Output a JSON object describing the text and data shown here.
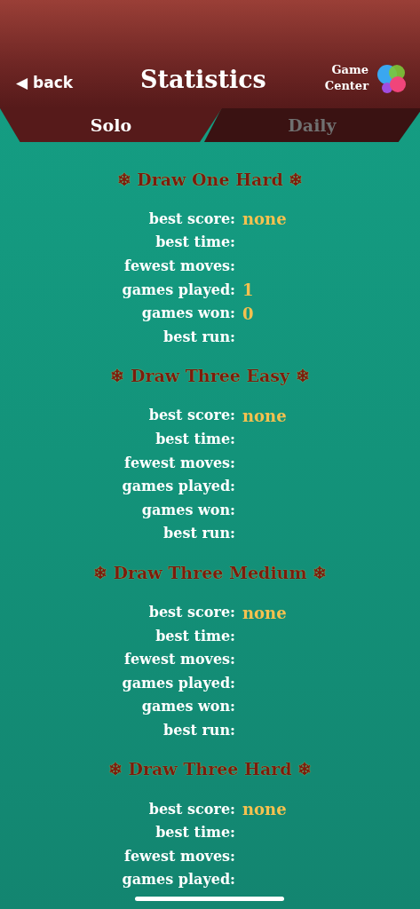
{
  "header": {
    "back": "◀ back",
    "title": "Statistics",
    "game_center": [
      "Game",
      "Center"
    ]
  },
  "tabs": [
    {
      "label": "Solo",
      "selected": true
    },
    {
      "label": "Daily",
      "selected": false
    }
  ],
  "sections": [
    {
      "title": "Draw One Hard",
      "rows": [
        {
          "label": "best score:",
          "value": "none"
        },
        {
          "label": "best time:"
        },
        {
          "label": "fewest moves:"
        },
        {
          "label": "games played:",
          "value": "1"
        },
        {
          "label": "games won:",
          "value": "0"
        },
        {
          "label": "best run:"
        }
      ]
    },
    {
      "title": "Draw Three Easy",
      "rows": [
        {
          "label": "best score:",
          "value": "none"
        },
        {
          "label": "best time:"
        },
        {
          "label": "fewest moves:"
        },
        {
          "label": "games played:"
        },
        {
          "label": "games won:"
        },
        {
          "label": "best run:"
        }
      ]
    },
    {
      "title": "Draw Three Medium",
      "rows": [
        {
          "label": "best score:",
          "value": "none"
        },
        {
          "label": "best time:"
        },
        {
          "label": "fewest moves:"
        },
        {
          "label": "games played:"
        },
        {
          "label": "games won:"
        },
        {
          "label": "best run:"
        }
      ]
    },
    {
      "title": "Draw Three Hard",
      "rows": [
        {
          "label": "best score:",
          "value": "none"
        },
        {
          "label": "best time:"
        },
        {
          "label": "fewest moves:"
        },
        {
          "label": "games played:"
        }
      ]
    }
  ],
  "title_ornament": "❄"
}
